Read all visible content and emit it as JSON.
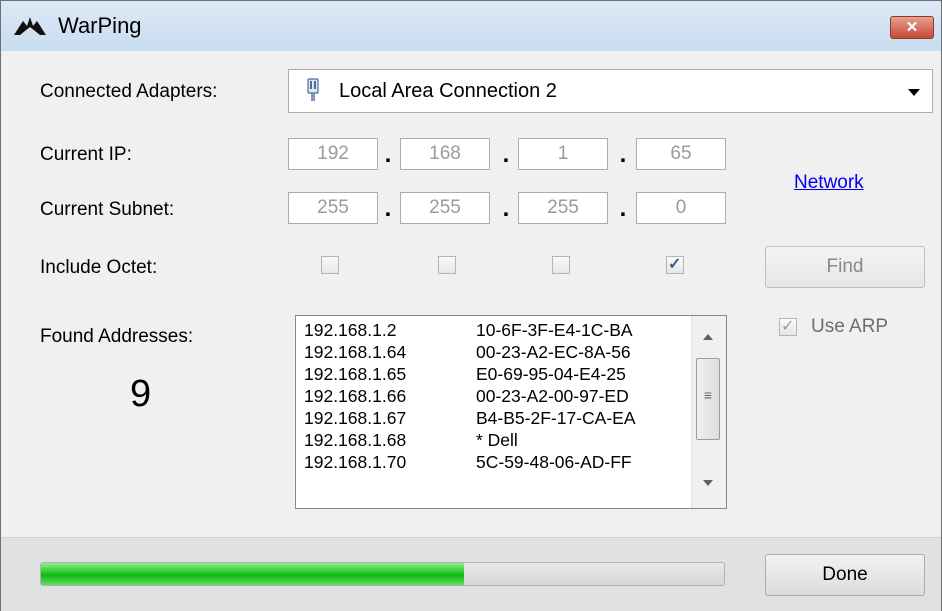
{
  "window": {
    "title": "WarPing",
    "close_label": "close"
  },
  "adapters": {
    "label": "Connected Adapters:",
    "selected": "Local Area Connection 2"
  },
  "ip": {
    "label": "Current IP:",
    "octets": [
      "192",
      "168",
      "1",
      "65"
    ]
  },
  "subnet": {
    "label": "Current Subnet:",
    "octets": [
      "255",
      "255",
      "255",
      "0"
    ]
  },
  "network_link": "Network",
  "include_octet": {
    "label": "Include Octet:",
    "checked": [
      false,
      false,
      false,
      true
    ]
  },
  "find_button": "Find",
  "use_arp": {
    "label": "Use ARP",
    "checked": true
  },
  "found": {
    "label": "Found Addresses:",
    "count": "9",
    "rows": [
      {
        "ip": "192.168.1.2",
        "mac": "10-6F-3F-E4-1C-BA"
      },
      {
        "ip": "192.168.1.64",
        "mac": "00-23-A2-EC-8A-56"
      },
      {
        "ip": "192.168.1.65",
        "mac": "E0-69-95-04-E4-25"
      },
      {
        "ip": "192.168.1.66",
        "mac": "00-23-A2-00-97-ED"
      },
      {
        "ip": "192.168.1.67",
        "mac": "B4-B5-2F-17-CA-EA"
      },
      {
        "ip": "192.168.1.68",
        "mac": "* Dell"
      },
      {
        "ip": "192.168.1.70",
        "mac": "5C-59-48-06-AD-FF"
      }
    ]
  },
  "progress": {
    "fraction": 0.62,
    "color": "#22c822"
  },
  "done_button": "Done"
}
